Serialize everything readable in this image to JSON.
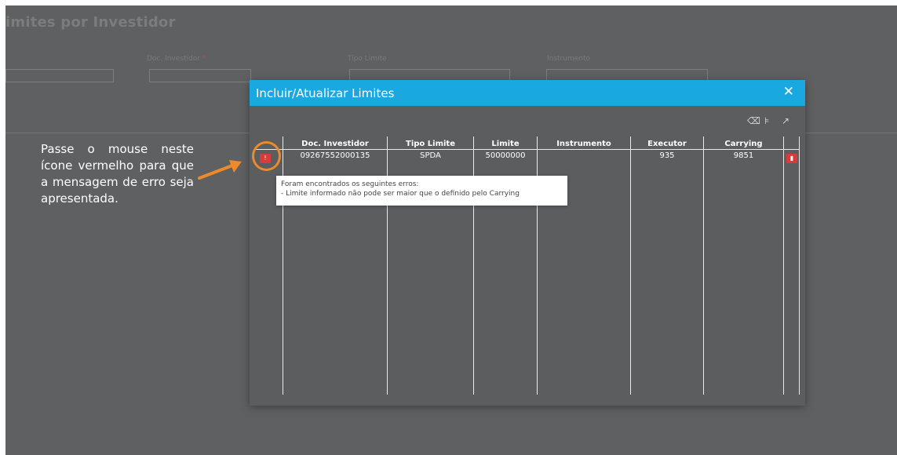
{
  "page": {
    "title": "imites por Investidor"
  },
  "filters": {
    "doc_label": "Doc. Investidor",
    "doc_required_mark": "*",
    "tipo_label": "Tipo Limite",
    "instrumento_label": "Instrumento"
  },
  "annotation": {
    "text": "Passe o mouse neste ícone vermelho para que a mensagem de erro seja apresentada.",
    "highlight_color": "#ec8a2c"
  },
  "modal": {
    "title": "Incluir/Atualizar Limites",
    "close_label": "✕",
    "header_color": "#1aa8e0",
    "toolbar": {
      "clear_icon": "⌫",
      "filter_icon": "⊧",
      "expand_icon": "↗"
    },
    "table": {
      "columns": [
        "Doc. Investidor",
        "Tipo Limite",
        "Limite",
        "Instrumento",
        "Executor",
        "Carrying"
      ],
      "rows": [
        {
          "doc_investidor": "09267552000135",
          "tipo_limite": "SPDA",
          "limite": "50000000",
          "instrumento": "",
          "executor": "935",
          "carrying": "9851",
          "error_icon": "!",
          "delete_icon": "▮"
        }
      ]
    },
    "tooltip": {
      "line1": "Foram encontrados os seguintes erros:",
      "line2": "- Limite informado não pode ser maior que o definido pelo Carrying"
    }
  }
}
